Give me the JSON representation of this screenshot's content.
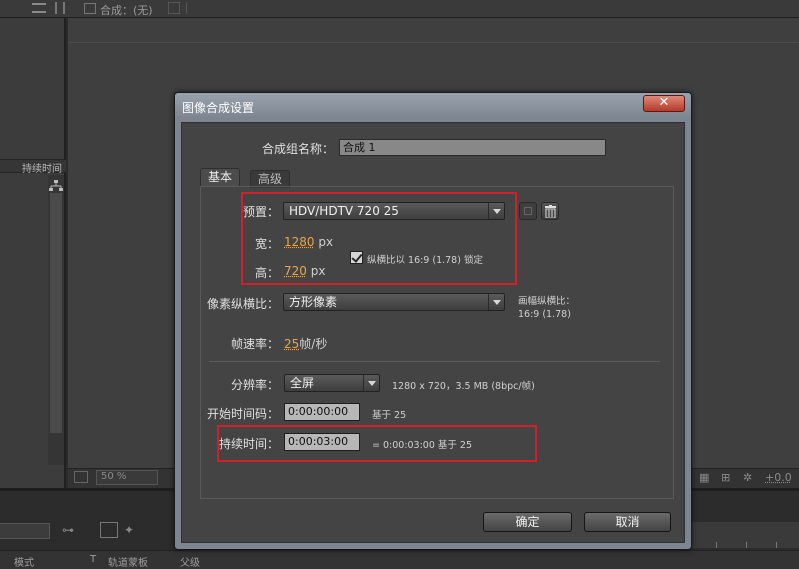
{
  "background": {
    "comp_tab_label": "合成：(无)",
    "duration_column_label": "持续时间",
    "zoom_level": "50 %",
    "exposure_value": "+0.0",
    "timeline_columns": {
      "mode": "模式",
      "t": "T",
      "track_matte": "轨道蒙板",
      "parent": "父级"
    }
  },
  "dialog": {
    "title": "图像合成设置",
    "close_symbol": "✕",
    "comp_name_label": "合成组名称：",
    "comp_name_value": "合成 1",
    "tabs": [
      {
        "label": "基本",
        "active": true
      },
      {
        "label": "高级",
        "active": false
      }
    ],
    "preset": {
      "label": "预置：",
      "value": "HDV/HDTV 720 25"
    },
    "width": {
      "label": "宽：",
      "value": "1280",
      "unit": "px"
    },
    "height": {
      "label": "高：",
      "value": "720",
      "unit": "px"
    },
    "lock_aspect": {
      "checked": true,
      "label": "纵横比以 16:9 (1.78) 锁定"
    },
    "pixel_aspect": {
      "label": "像素纵横比：",
      "value": "方形像素",
      "frame_aspect_label": "画幅纵横比：",
      "frame_aspect_value": "16:9 (1.78)"
    },
    "frame_rate": {
      "label": "帧速率：",
      "value": "25",
      "unit": "帧/秒"
    },
    "resolution": {
      "label": "分辨率：",
      "value": "全屏",
      "info": "1280 x 720，3.5 MB (8bpc/帧)"
    },
    "start_timecode": {
      "label": "开始时间码：",
      "value": "0:00:00:00",
      "note": "基于 25"
    },
    "duration": {
      "label": "持续时间：",
      "value": "0:00:03:00",
      "note": "= 0:00:03:00  基于 25"
    },
    "ok_label": "确定",
    "cancel_label": "取消"
  },
  "colors": {
    "highlight_box": "#d0202c",
    "value_orange": "#e8a64a",
    "dialog_bg": "#444444"
  }
}
